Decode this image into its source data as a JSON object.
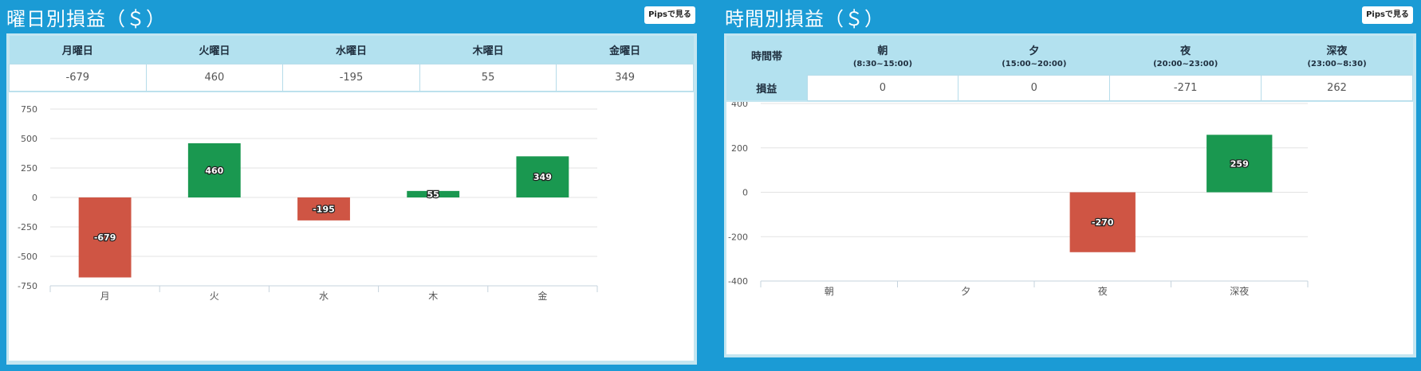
{
  "panels": {
    "weekday": {
      "title": "曜日別損益（＄）",
      "pips_button": "Pipsで見る",
      "headers": [
        "月曜日",
        "火曜日",
        "水曜日",
        "木曜日",
        "金曜日"
      ],
      "values": [
        "-679",
        "460",
        "-195",
        "55",
        "349"
      ]
    },
    "hourly": {
      "title": "時間別損益（＄）",
      "pips_button": "Pipsで見る",
      "row_header_time": "時間帯",
      "row_header_pnl": "損益",
      "headers": [
        {
          "label": "朝",
          "range": "(8:30~15:00)"
        },
        {
          "label": "夕",
          "range": "(15:00~20:00)"
        },
        {
          "label": "夜",
          "range": "(20:00~23:00)"
        },
        {
          "label": "深夜",
          "range": "(23:00~8:30)"
        }
      ],
      "values": [
        "0",
        "0",
        "-271",
        "262"
      ]
    }
  },
  "colors": {
    "positive": "#1a9850",
    "negative": "#cf5544",
    "background": "#1b9bd5",
    "header": "#b3e1ef"
  },
  "chart_data": [
    {
      "type": "bar",
      "categories": [
        "月",
        "火",
        "水",
        "木",
        "金"
      ],
      "values": [
        -679,
        460,
        -195,
        55,
        349
      ],
      "labels": [
        "-679",
        "460",
        "-195",
        "55",
        "349"
      ],
      "ylim": [
        -750,
        750
      ],
      "yticks": [
        750,
        500,
        250,
        0,
        -250,
        -500,
        -750
      ],
      "ytick_labels": [
        "750",
        "500",
        "250",
        "0",
        "-250",
        "-500",
        "-750"
      ],
      "grid": true
    },
    {
      "type": "bar",
      "categories": [
        "朝",
        "夕",
        "夜",
        "深夜"
      ],
      "values": [
        0,
        0,
        -270,
        259
      ],
      "labels": [
        "",
        "",
        "-270",
        "259"
      ],
      "ylim": [
        -400,
        400
      ],
      "yticks": [
        400,
        200,
        0,
        -200,
        -400
      ],
      "ytick_labels": [
        "400",
        "200",
        "0",
        "-200",
        "-400"
      ],
      "grid": true
    }
  ]
}
